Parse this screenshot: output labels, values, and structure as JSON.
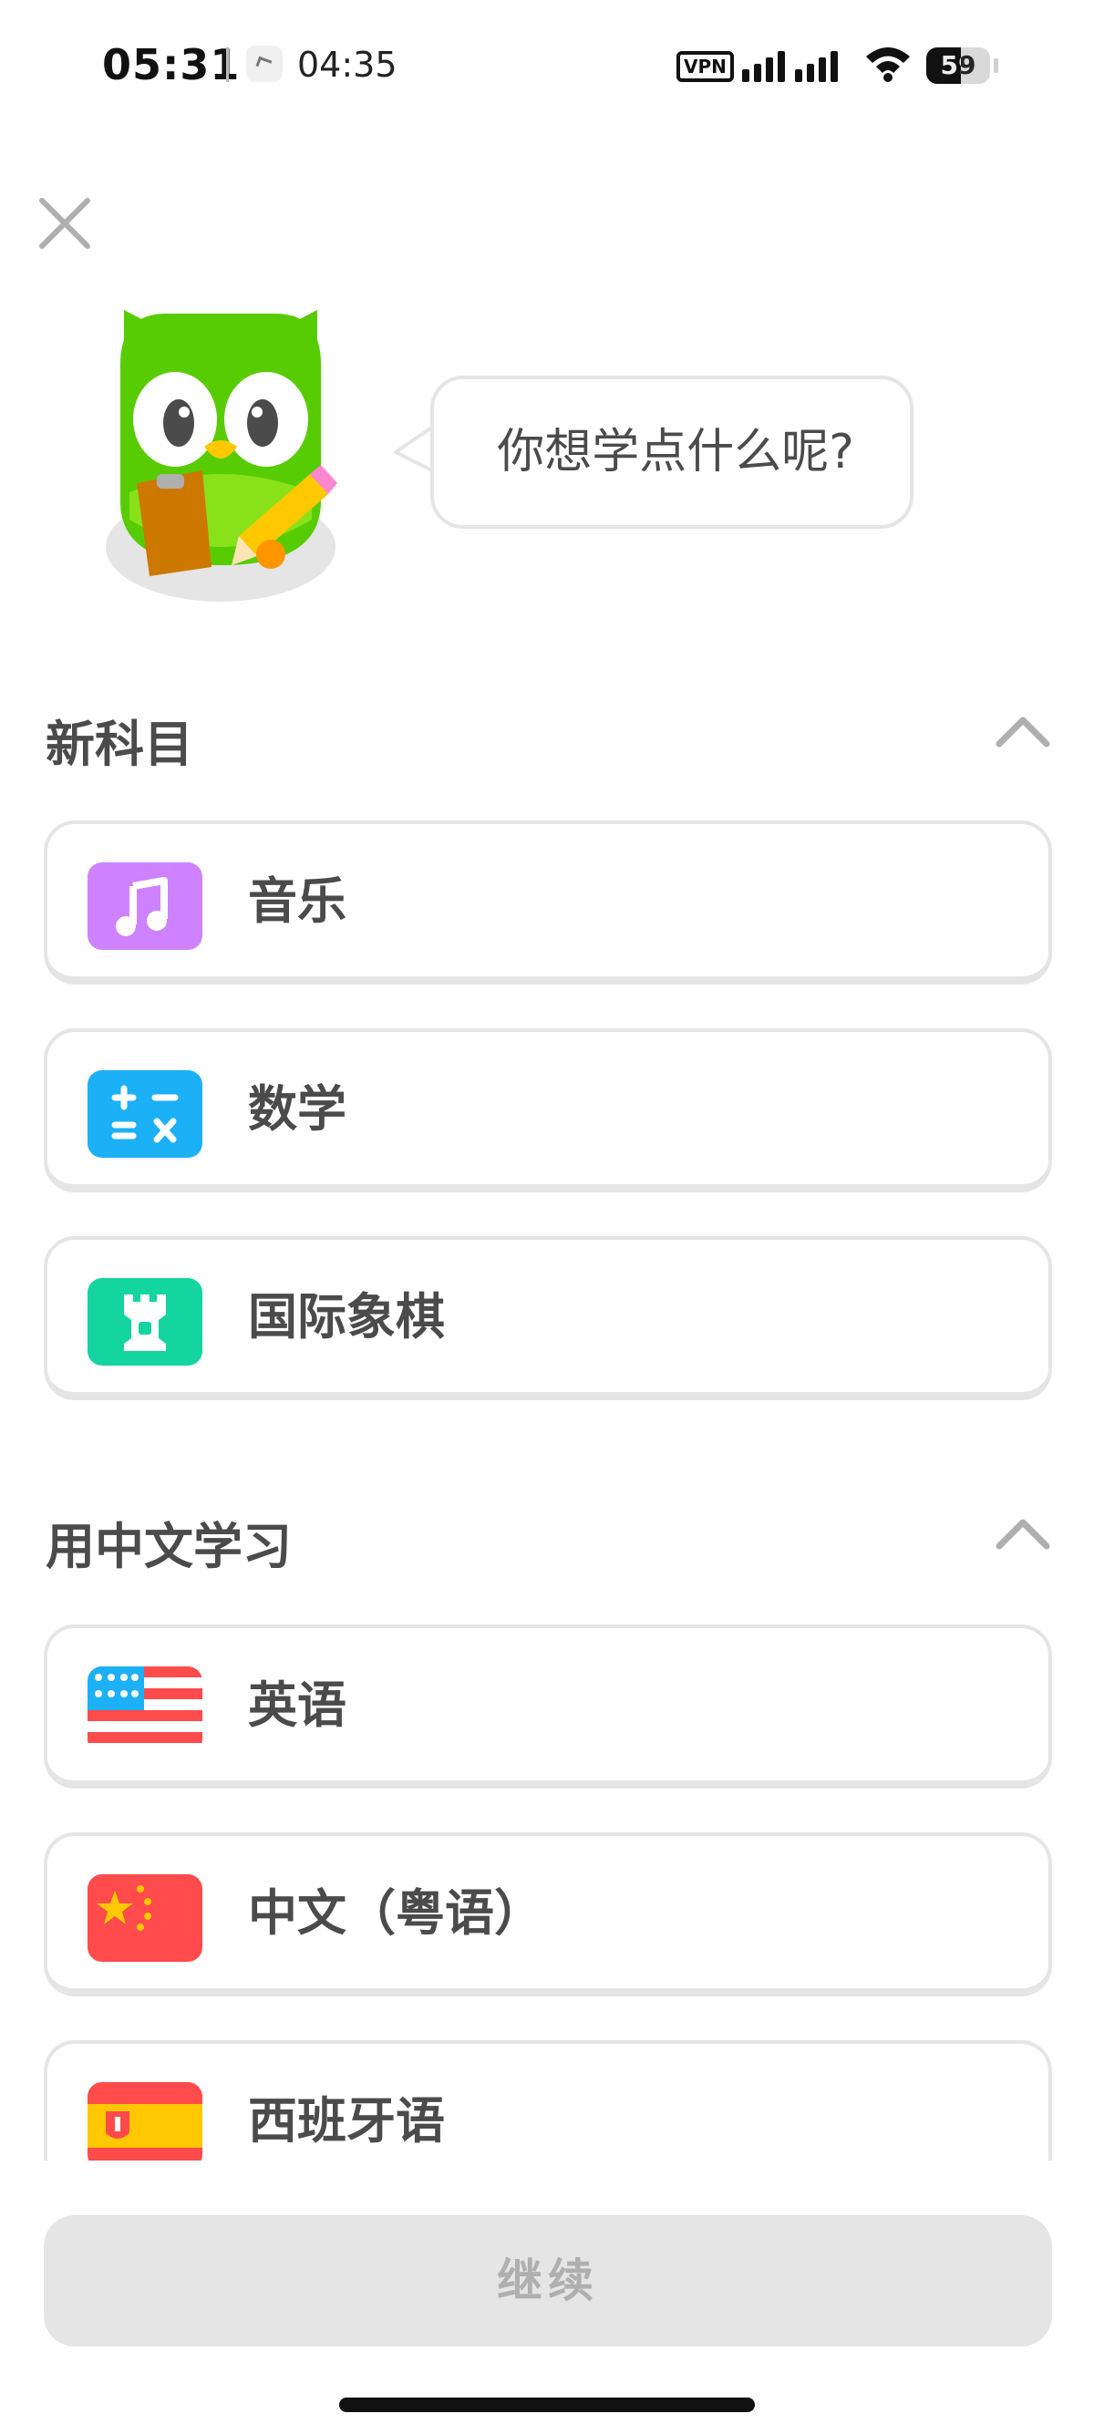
{
  "status_bar": {
    "time": "05:31",
    "secondary_time": "04:35",
    "vpn": "VPN",
    "battery": "59"
  },
  "greeting": {
    "bubble_text": "你想学点什么呢?"
  },
  "sections": {
    "new_subjects": {
      "title": "新科目",
      "items": [
        {
          "label": "音乐",
          "icon": "music-icon",
          "color": "#ce82ff"
        },
        {
          "label": "数学",
          "icon": "math-icon",
          "color": "#1cb0f6"
        },
        {
          "label": "国际象棋",
          "icon": "chess-rook-icon",
          "color": "#14d4a0"
        }
      ]
    },
    "learn_in_chinese": {
      "title": "用中文学习",
      "items": [
        {
          "label": "英语",
          "icon": "us-flag-icon"
        },
        {
          "label": "中文（粤语）",
          "icon": "china-flag-icon"
        },
        {
          "label": "西班牙语",
          "icon": "spain-flag-icon"
        }
      ]
    }
  },
  "footer": {
    "continue_label": "继续"
  },
  "colors": {
    "border": "#e5e5e5",
    "text": "#4b4b4b",
    "disabled_button": "#e5e5e5",
    "disabled_text": "#afafaf",
    "owl_green": "#58cc02"
  }
}
